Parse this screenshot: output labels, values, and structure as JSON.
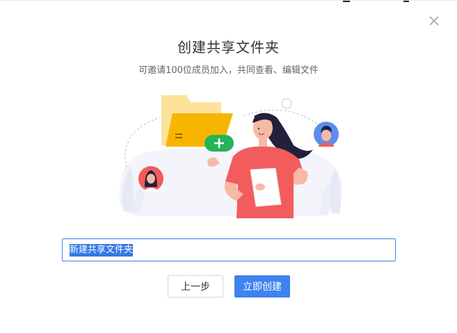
{
  "dialog": {
    "title": "创建共享文件夹",
    "subtitle": "可邀请100位成员加入，共同查看、编辑文件",
    "close_icon": "close-icon"
  },
  "form": {
    "folder_name_value": "新建共享文件夹"
  },
  "actions": {
    "prev_label": "上一步",
    "create_label": "立即创建"
  },
  "colors": {
    "primary": "#3f83f0",
    "folder": "#f7b500",
    "plus_badge": "#27b35a",
    "shirt": "#f25c5c"
  }
}
